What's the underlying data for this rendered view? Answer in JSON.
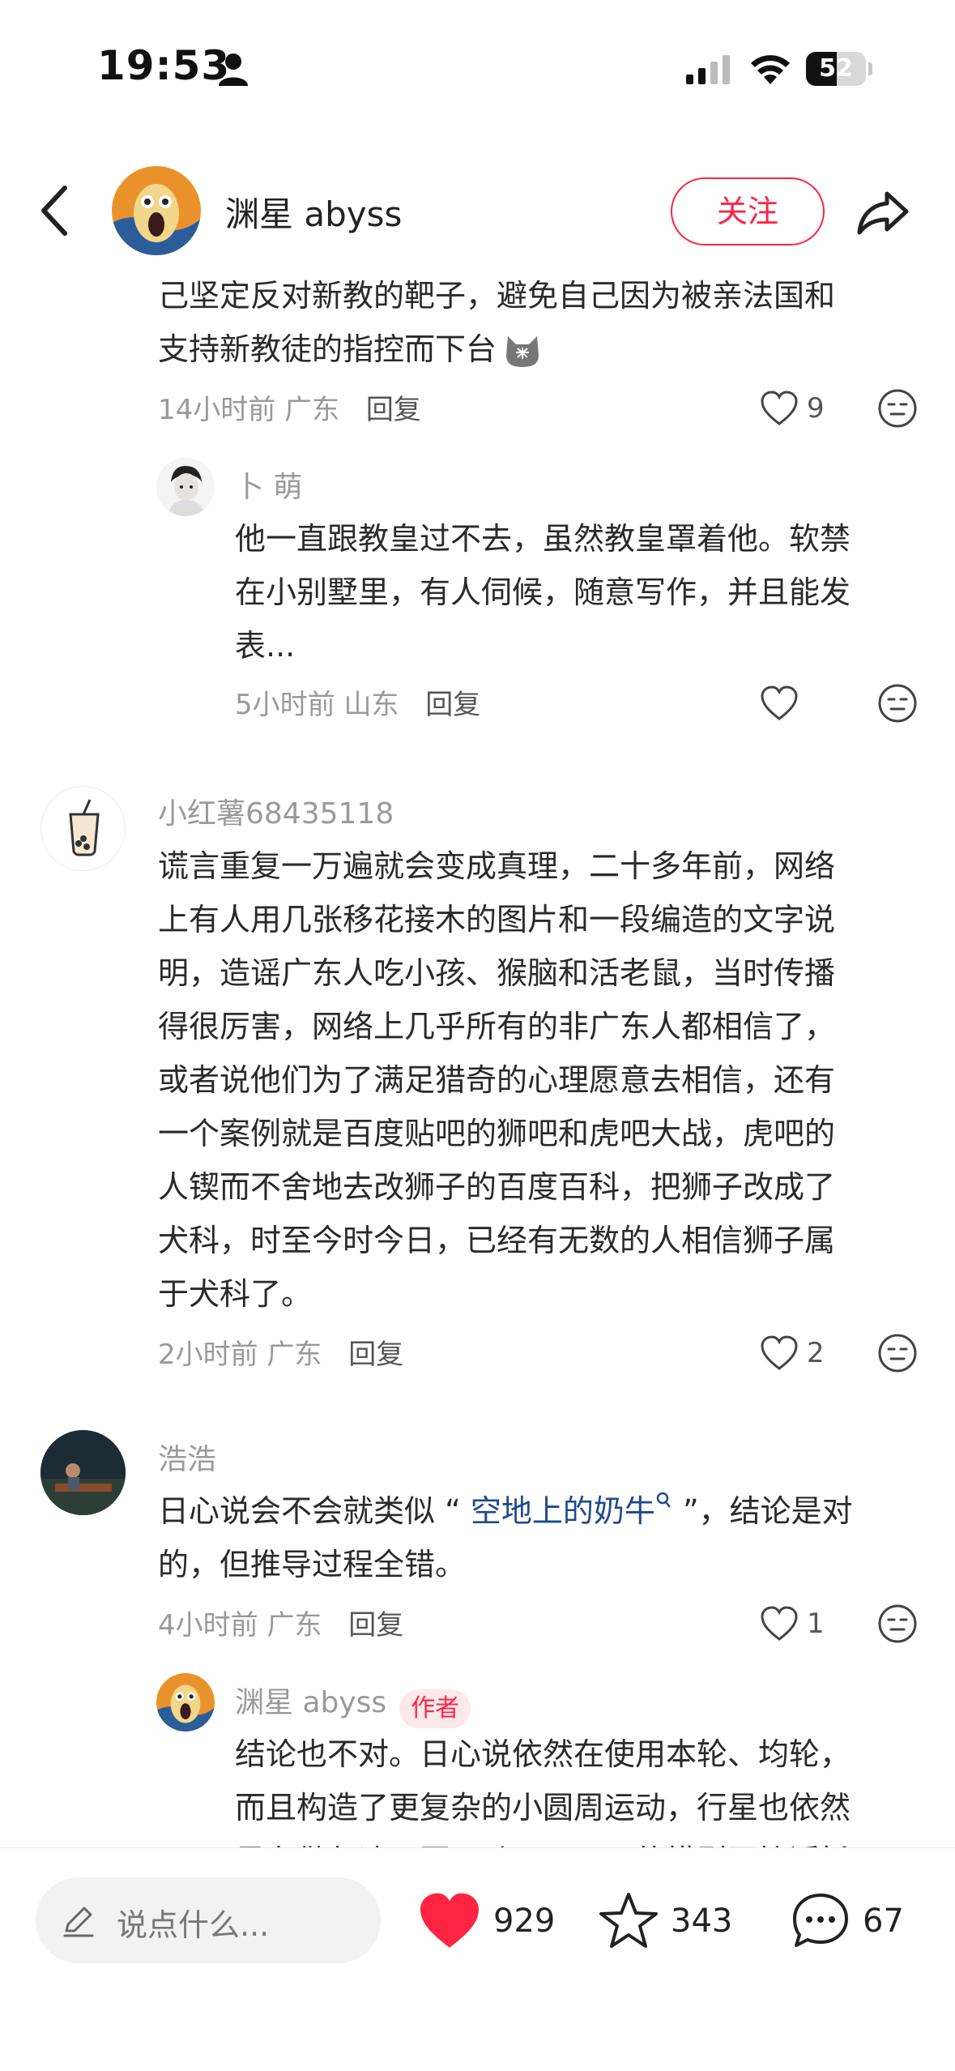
{
  "status_bar": {
    "time": "19:53",
    "battery": "52",
    "battery_fraction": 0.52
  },
  "header": {
    "author_name": "渊星 abyss",
    "follow_label": "关注",
    "icons": [
      "back-icon",
      "share-icon"
    ]
  },
  "comments": {
    "c1": {
      "text_line1": "己坚定反对新教的靶子，避免自己因为被亲法国和",
      "text_line2": "支持新教徒的指控而下台",
      "time": "14小时前",
      "location": "广东",
      "reply_label": "回复",
      "likes": "9",
      "reply": {
        "username": "卜 萌",
        "text_line1": "他一直跟教皇过不去，虽然教皇罩着他。软禁",
        "text_line2": "在小别墅里，有人伺候，随意写作，并且能发",
        "text_line3": "表...",
        "time": "5小时前",
        "location": "山东",
        "reply_label": "回复"
      }
    },
    "c2": {
      "username": "小红薯68435118",
      "lines": [
        "谎言重复一万遍就会变成真理，二十多年前，网络",
        "上有人用几张移花接木的图片和一段编造的文字说",
        "明，造谣广东人吃小孩、猴脑和活老鼠，当时传播",
        "得很厉害，网络上几乎所有的非广东人都相信了，",
        "或者说他们为了满足猎奇的心理愿意去相信，还有",
        "一个案例就是百度贴吧的狮吧和虎吧大战，虎吧的",
        "人锲而不舍地去改狮子的百度百科，把狮子改成了",
        "犬科，时至今时今日，已经有无数的人相信狮子属",
        "于犬科了。"
      ],
      "time": "2小时前",
      "location": "广东",
      "reply_label": "回复",
      "likes": "2"
    },
    "c3": {
      "username": "浩浩",
      "text_before": "日心说会不会就类似 “ ",
      "link": "空地上的奶牛",
      "text_after": " ”，结论是对",
      "text_line2": "的，但推导过程全错。",
      "time": "4小时前",
      "location": "广东",
      "reply_label": "回复",
      "likes": "1",
      "reply": {
        "username": "渊星 abyss",
        "tag": "作者",
        "text_line1": "结论也不对。日心说依然在使用本轮、均轮，",
        "text_line2": "而且构造了更复杂的小圆周运动，行星也依然",
        "text_line3": "是在做匀速正圆运动，而且目的模型更接近托"
      }
    }
  },
  "bottom_bar": {
    "input_placeholder": "说点什么...",
    "like_count": "929",
    "collect_count": "343",
    "comment_count": "67",
    "colors": {
      "accent": "#ff2442"
    }
  }
}
